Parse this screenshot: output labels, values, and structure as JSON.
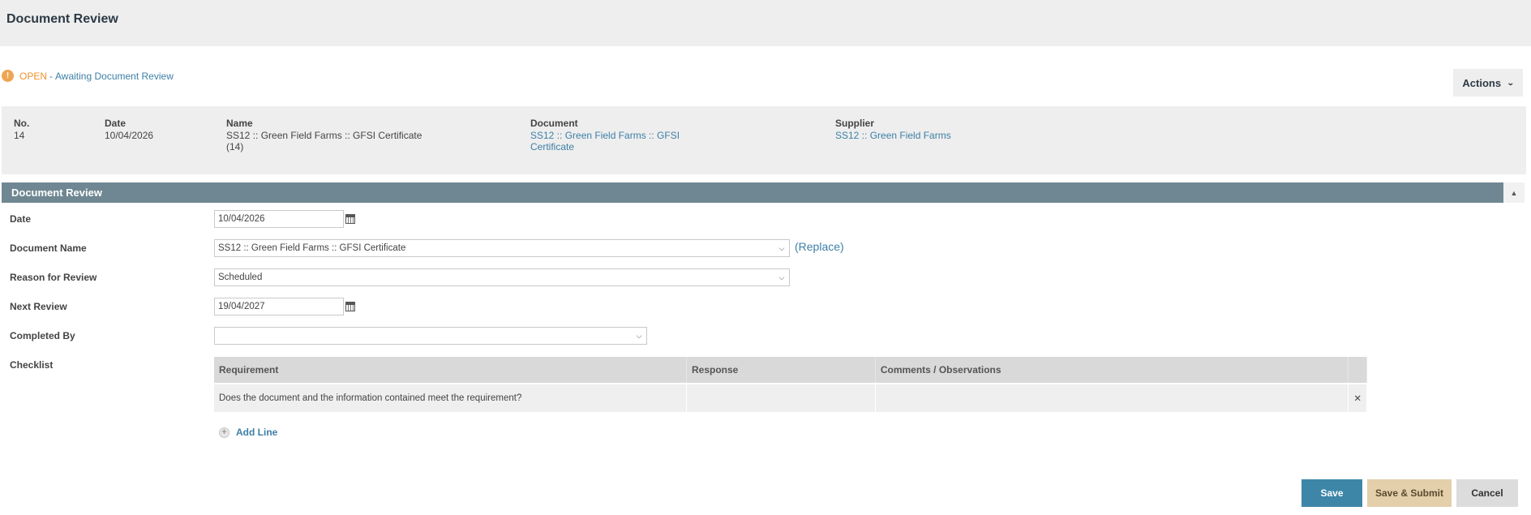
{
  "header": {
    "title": "Document Review"
  },
  "status": {
    "icon": "alert-icon",
    "state": "OPEN",
    "separator": "-",
    "description": "Awaiting Document Review"
  },
  "actions_label": "Actions",
  "summary": {
    "no": {
      "label": "No.",
      "value": "14"
    },
    "date": {
      "label": "Date",
      "value": "10/04/2026"
    },
    "name": {
      "label": "Name",
      "line1": "SS12 :: Green Field Farms :: GFSI Certificate",
      "line2": "(14)"
    },
    "document": {
      "label": "Document",
      "line1": "SS12 :: Green Field Farms :: GFSI",
      "line2": "Certificate"
    },
    "supplier": {
      "label": "Supplier",
      "value": "SS12 :: Green Field Farms"
    }
  },
  "section": {
    "title": "Document Review"
  },
  "form": {
    "date": {
      "label": "Date",
      "value": "10/04/2026"
    },
    "document_name": {
      "label": "Document Name",
      "value": "SS12 :: Green Field Farms :: GFSI Certificate",
      "replace": "(Replace)"
    },
    "reason": {
      "label": "Reason for Review",
      "value": "Scheduled"
    },
    "next_review": {
      "label": "Next Review",
      "value": "19/04/2027"
    },
    "completed_by": {
      "label": "Completed By",
      "value": ""
    },
    "checklist_label": "Checklist"
  },
  "checklist": {
    "headers": [
      "Requirement",
      "Response",
      "Comments / Observations"
    ],
    "rows": [
      {
        "requirement": "Does the document and the information contained meet the requirement?",
        "response": "",
        "comments": ""
      }
    ],
    "add_line": "Add Line"
  },
  "buttons": {
    "save": "Save",
    "save_submit": "Save & Submit",
    "cancel": "Cancel"
  },
  "colors": {
    "section_bar": "#6f8792",
    "save": "#3d86a8",
    "save_submit": "#e3cfaa",
    "status_open": "#f0922e",
    "link": "#3d7fa6"
  }
}
